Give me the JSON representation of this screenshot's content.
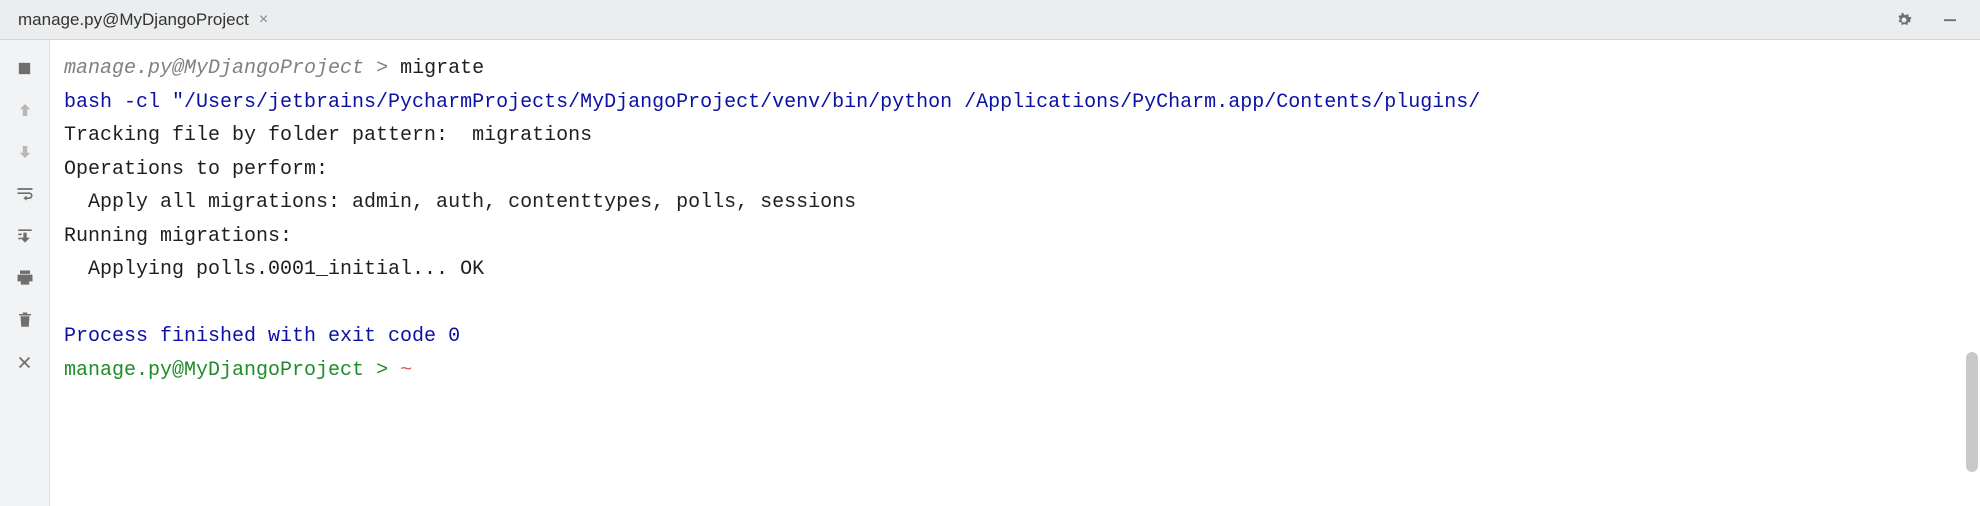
{
  "header": {
    "tab_title": "manage.py@MyDjangoProject",
    "close_glyph": "×"
  },
  "prompt": {
    "context": "manage.py@MyDjangoProject",
    "separator": ">",
    "command": "migrate"
  },
  "output": {
    "bash_line": "bash -cl \"/Users/jetbrains/PycharmProjects/MyDjangoProject/venv/bin/python /Applications/PyCharm.app/Contents/plugins/",
    "tracking_line": "Tracking file by folder pattern:  migrations",
    "operations_header": "Operations to perform:",
    "apply_all": "  Apply all migrations: admin, auth, contenttypes, polls, sessions",
    "running_header": "Running migrations:",
    "applying_line": "  Applying polls.0001_initial... OK",
    "finished_line": "Process finished with exit code 0"
  },
  "final_prompt": {
    "context": "manage.py@MyDjangoProject",
    "separator": ">",
    "caret": "~"
  }
}
